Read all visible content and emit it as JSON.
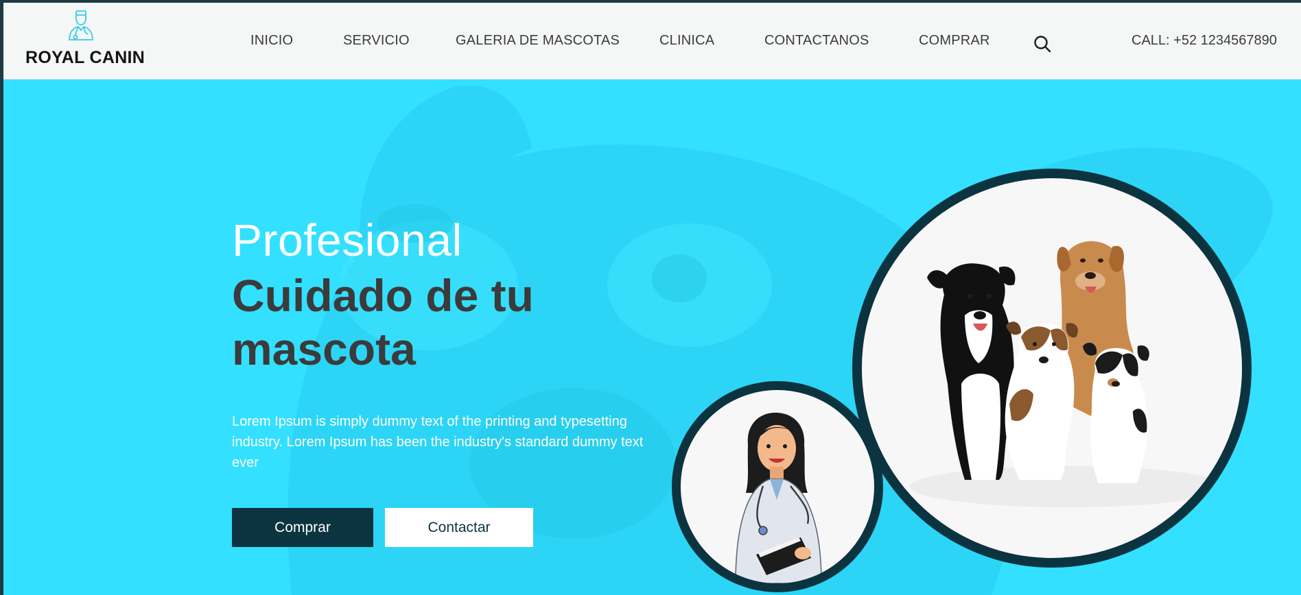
{
  "brand": {
    "name": "ROYAL CANIN",
    "icon": "veterinarian-icon"
  },
  "nav": {
    "items": [
      {
        "label": "INICIO"
      },
      {
        "label": "SERVICIO"
      },
      {
        "label": "GALERIA DE MASCOTAS"
      },
      {
        "label": "CLINICA"
      },
      {
        "label": "CONTACTANOS"
      },
      {
        "label": "COMPRAR"
      }
    ],
    "search_icon": "search-icon",
    "call": "CALL: +52 1234567890"
  },
  "hero": {
    "title_light": "Profesional",
    "title_bold": "Cuidado de tu mascota",
    "description": "Lorem Ipsum is simply dummy text of the printing and typesetting industry. Lorem Ipsum has been the industry's standard dummy text ever",
    "buttons": {
      "primary": "Comprar",
      "secondary": "Contactar"
    },
    "images": {
      "large": "dogs-photo",
      "small": "veterinarian-illustration"
    }
  },
  "colors": {
    "hero_bg": "#33e0ff",
    "dark_teal": "#0c3440",
    "header_bg": "#f5f6f6",
    "title_dark": "#3b3b3b",
    "logo_icon": "#2fcfe8"
  }
}
